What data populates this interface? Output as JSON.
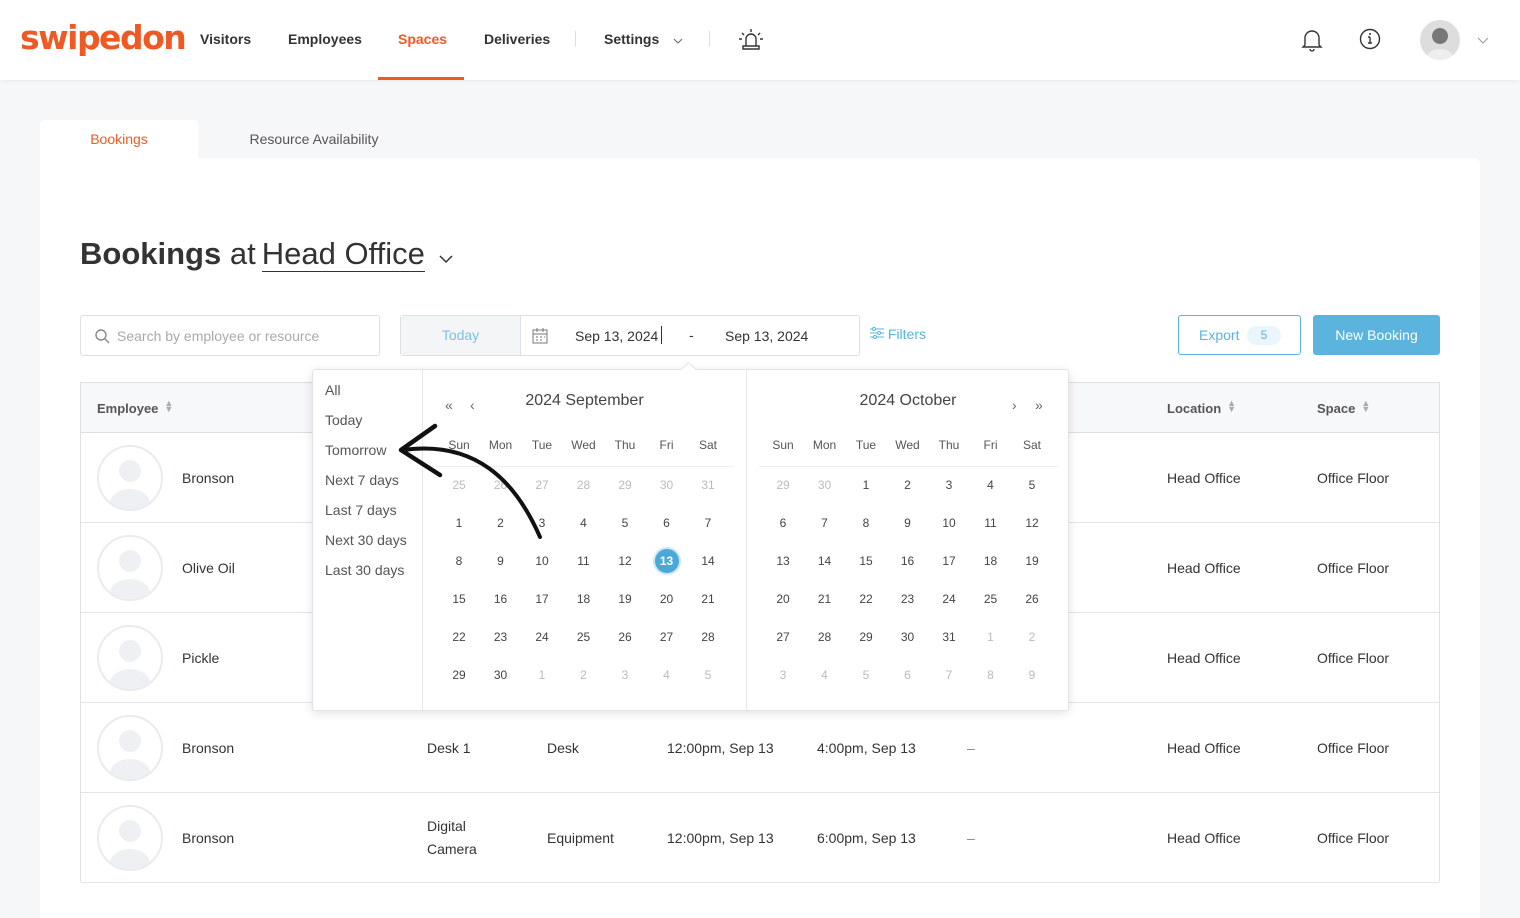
{
  "brand": {
    "logo": "swipedon",
    "accent": "#ef5a24",
    "primary": "#5ab4dd"
  },
  "nav": {
    "items": [
      {
        "label": "Visitors"
      },
      {
        "label": "Employees"
      },
      {
        "label": "Spaces",
        "active": true
      },
      {
        "label": "Deliveries"
      },
      {
        "label": "Settings"
      }
    ],
    "icons": [
      "alarm-icon",
      "bell-icon",
      "info-icon",
      "avatar",
      "chevron-down-icon"
    ]
  },
  "tabs": [
    {
      "label": "Bookings",
      "active": true
    },
    {
      "label": "Resource Availability"
    }
  ],
  "page": {
    "title_bold": "Bookings",
    "title_at": "at",
    "location": "Head Office"
  },
  "toolbar": {
    "search_placeholder": "Search by employee or resource",
    "today": "Today",
    "start_date": "Sep 13, 2024",
    "date_sep": "-",
    "end_date": "Sep 13, 2024",
    "filters": "Filters",
    "export": "Export",
    "export_count": "5",
    "new_booking": "New Booking"
  },
  "table": {
    "headers": {
      "employee": "Employee",
      "location": "Location",
      "space": "Space"
    },
    "rows": [
      {
        "employee": "Bronson",
        "location": "Head Office",
        "space": "Office Floor"
      },
      {
        "employee": "Olive Oil",
        "location": "Head Office",
        "space": "Office Floor"
      },
      {
        "employee": "Pickle",
        "location": "Head Office",
        "space": "Office Floor"
      },
      {
        "employee": "Bronson",
        "resource": "Desk 1",
        "type": "Desk",
        "start": "12:00pm, Sep 13",
        "end": "4:00pm, Sep 13",
        "extra": "–",
        "location": "Head Office",
        "space": "Office Floor"
      },
      {
        "employee": "Bronson",
        "resource_line1": "Digital",
        "resource_line2": "Camera",
        "type": "Equipment",
        "start": "12:00pm, Sep 13",
        "end": "6:00pm, Sep 13",
        "extra": "–",
        "location": "Head Office",
        "space": "Office Floor"
      }
    ]
  },
  "picker": {
    "presets": [
      "All",
      "Today",
      "Tomorrow",
      "Next 7 days",
      "Last 7 days",
      "Next 30 days",
      "Last 30 days"
    ],
    "weekdays": [
      "Sun",
      "Mon",
      "Tue",
      "Wed",
      "Thu",
      "Fri",
      "Sat"
    ],
    "months": [
      {
        "title": "2024 September",
        "selected": 13,
        "weeks": [
          [
            25,
            26,
            27,
            28,
            29,
            30,
            31
          ],
          [
            1,
            2,
            3,
            4,
            5,
            6,
            7
          ],
          [
            8,
            9,
            10,
            11,
            12,
            13,
            14
          ],
          [
            15,
            16,
            17,
            18,
            19,
            20,
            21
          ],
          [
            22,
            23,
            24,
            25,
            26,
            27,
            28
          ],
          [
            29,
            30,
            1,
            2,
            3,
            4,
            5
          ]
        ],
        "first_in_month_row0": false
      },
      {
        "title": "2024 October",
        "weeks": [
          [
            29,
            30,
            1,
            2,
            3,
            4,
            5
          ],
          [
            6,
            7,
            8,
            9,
            10,
            11,
            12
          ],
          [
            13,
            14,
            15,
            16,
            17,
            18,
            19
          ],
          [
            20,
            21,
            22,
            23,
            24,
            25,
            26
          ],
          [
            27,
            28,
            29,
            30,
            31,
            1,
            2
          ],
          [
            3,
            4,
            5,
            6,
            7,
            8,
            9
          ]
        ]
      }
    ]
  }
}
